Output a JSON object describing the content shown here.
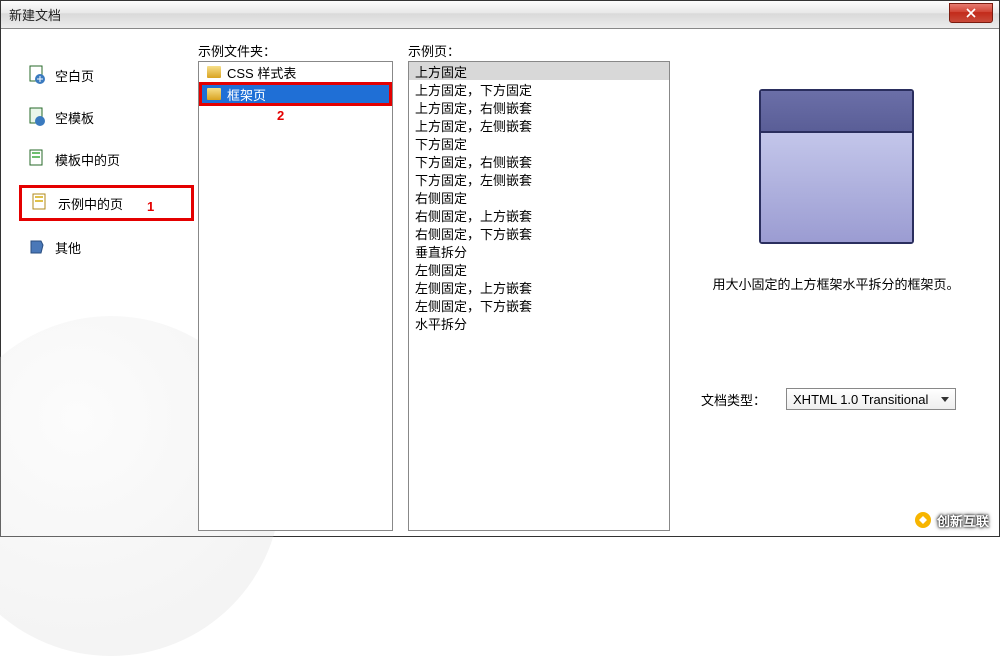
{
  "window": {
    "title": "新建文档"
  },
  "categories": [
    {
      "icon": "blank-page-icon",
      "label": "空白页"
    },
    {
      "icon": "blank-template-icon",
      "label": "空模板"
    },
    {
      "icon": "template-page-icon",
      "label": "模板中的页"
    },
    {
      "icon": "sample-page-icon",
      "label": "示例中的页"
    },
    {
      "icon": "other-icon",
      "label": "其他"
    }
  ],
  "annotations": {
    "cat": "1",
    "folder": "2"
  },
  "columns": {
    "folders": "示例文件夹：",
    "pages": "示例页："
  },
  "folders": [
    {
      "label": "CSS 样式表",
      "selected": false
    },
    {
      "label": "框架页",
      "selected": true
    }
  ],
  "pages": [
    "上方固定",
    "上方固定，下方固定",
    "上方固定，右侧嵌套",
    "上方固定，左侧嵌套",
    "下方固定",
    "下方固定，右侧嵌套",
    "下方固定，左侧嵌套",
    "右侧固定",
    "右侧固定，上方嵌套",
    "右侧固定，下方嵌套",
    "垂直拆分",
    "左侧固定",
    "左侧固定，上方嵌套",
    "左侧固定，下方嵌套",
    "水平拆分"
  ],
  "selected_page_index": 0,
  "preview": {
    "description": "用大小固定的上方框架水平拆分的框架页。"
  },
  "doctype": {
    "label": "文档类型：",
    "value": "XHTML 1.0 Transitional"
  },
  "watermark": "创新互联"
}
